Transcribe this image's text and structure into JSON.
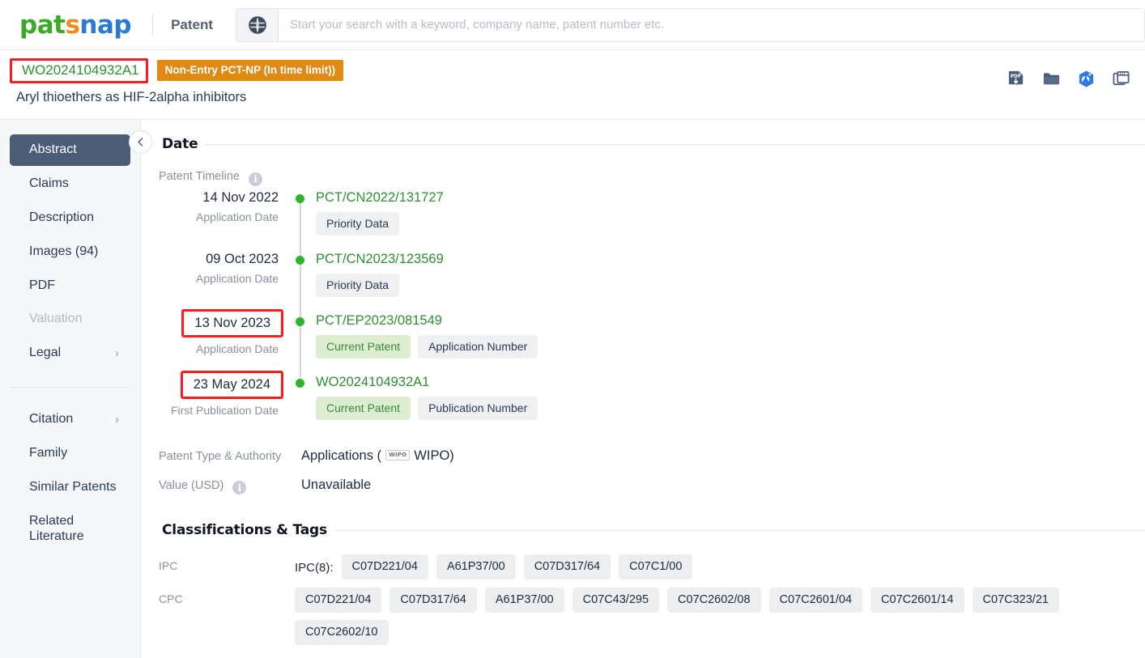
{
  "header": {
    "logo_pat": "pat",
    "logo_s": "s",
    "logo_nap": "nap",
    "nav_label": "Patent",
    "search_placeholder": "Start your search with a keyword, company name, patent number etc.",
    "search_value": "",
    "icons": [
      "pdf-download-icon",
      "folder-icon",
      "chemistry-badge-icon",
      "windows-copy-icon"
    ]
  },
  "patent": {
    "number": "WO2024104932A1",
    "legal_status": "Non-Entry PCT-NP (In time limit))",
    "title": "Aryl thioethers as HIF-2alpha inhibitors"
  },
  "sidebar": {
    "items": [
      {
        "label": "Abstract",
        "state": "active",
        "chevron": ""
      },
      {
        "label": "Claims",
        "state": "normal",
        "chevron": ""
      },
      {
        "label": "Description",
        "state": "normal",
        "chevron": ""
      },
      {
        "label": "Images (94)",
        "state": "normal",
        "chevron": ""
      },
      {
        "label": "PDF",
        "state": "normal",
        "chevron": ""
      },
      {
        "label": "Valuation",
        "state": "disabled",
        "chevron": ""
      },
      {
        "label": "Legal",
        "state": "normal",
        "chevron": "›"
      }
    ],
    "items2": [
      {
        "label": "Citation",
        "state": "normal",
        "chevron": "›"
      },
      {
        "label": "Family",
        "state": "normal",
        "chevron": ""
      },
      {
        "label": "Similar Patents",
        "state": "normal",
        "chevron": ""
      },
      {
        "label": "Related Literature",
        "state": "normal",
        "chevron": ""
      }
    ],
    "collapse_icon": "chevron-left-icon"
  },
  "date_section": {
    "title": "Date",
    "timeline_label": "Patent Timeline",
    "timeline_info": "i",
    "events": [
      {
        "date": "14 Nov 2022",
        "date_highlighted": false,
        "sub": "Application Date",
        "number": "PCT/CN2022/131727",
        "chips": [
          {
            "text": "Priority Data",
            "style": "grey"
          }
        ]
      },
      {
        "date": "09 Oct 2023",
        "date_highlighted": false,
        "sub": "Application Date",
        "number": "PCT/CN2023/123569",
        "chips": [
          {
            "text": "Priority Data",
            "style": "grey"
          }
        ]
      },
      {
        "date": "13 Nov 2023",
        "date_highlighted": true,
        "sub": "Application Date",
        "number": "PCT/EP2023/081549",
        "chips": [
          {
            "text": "Current Patent",
            "style": "green"
          },
          {
            "text": "Application Number",
            "style": "grey"
          }
        ]
      },
      {
        "date": "23 May 2024",
        "date_highlighted": true,
        "sub": "First Publication Date",
        "number": "WO2024104932A1",
        "chips": [
          {
            "text": "Current Patent",
            "style": "green"
          },
          {
            "text": "Publication Number",
            "style": "grey"
          }
        ]
      }
    ],
    "type_label": "Patent Type & Authority",
    "type_value_pre": "Applications (",
    "type_badge": "WIPO",
    "type_value_post": "WIPO)",
    "value_label": "Value (USD)",
    "value_info": "i",
    "value_value": "Unavailable"
  },
  "classifications": {
    "title": "Classifications & Tags",
    "ipc_label": "IPC",
    "ipc_prefix": "IPC(8):",
    "ipc_tags": [
      "C07D221/04",
      "A61P37/00",
      "C07D317/64",
      "C07C1/00"
    ],
    "cpc_label": "CPC",
    "cpc_tags": [
      "C07D221/04",
      "C07D317/64",
      "A61P37/00",
      "C07C43/295",
      "C07C2602/08",
      "C07C2601/04",
      "C07C2601/14",
      "C07C323/21",
      "C07C2602/10"
    ]
  },
  "colors": {
    "brand_green": "#3aa928",
    "brand_orange": "#f08a1e",
    "brand_blue": "#2a7ad4",
    "legal_badge": "#e08a14",
    "link_green": "#2f8f33",
    "timeline_dot": "#2cb42c",
    "highlight_box": "#f81e1e",
    "sidebar_active": "#4c5c77"
  }
}
